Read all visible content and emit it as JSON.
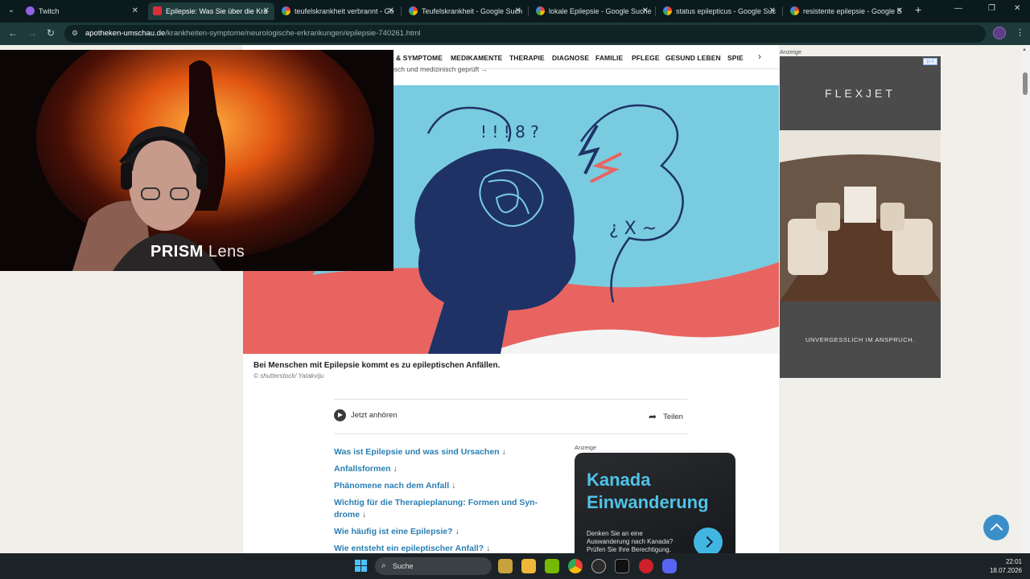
{
  "browser": {
    "tabs": [
      {
        "title": "Twitch",
        "favicon": "twitch-favicon",
        "active": false
      },
      {
        "title": "Epilepsie: Was Sie über die Kra",
        "favicon": "apotheken-umschau-favicon",
        "active": true
      },
      {
        "title": "teufelskrankheit verbrannt - Go",
        "favicon": "google-favicon",
        "active": false
      },
      {
        "title": "Teufelskrankheit - Google Such",
        "favicon": "google-favicon",
        "active": false
      },
      {
        "title": "lokale Epilepsie - Google Suche",
        "favicon": "google-favicon",
        "active": false
      },
      {
        "title": "status epilepticus - Google Suc",
        "favicon": "google-favicon",
        "active": false
      },
      {
        "title": "resistente epilepsie - Google S",
        "favicon": "google-favicon",
        "active": false
      }
    ],
    "url_host": "apotheken-umschau.de",
    "url_path": "/krankheiten-symptome/neurologische-erkrankungen/epilepsie-740261.html"
  },
  "site_nav": {
    "items": [
      "& SYMPTOME",
      "MEDIKAMENTE",
      "THERAPIE",
      "DIAGNOSE",
      "FAMILIE",
      "PFLEGE",
      "GESUND LEBEN",
      "SPIE"
    ],
    "subline": "isch und medizinisch geprüft"
  },
  "article": {
    "image_caption": "Bei Menschen mit Epilepsie kommt es zu epileptischen Anfällen.",
    "image_credit": "© shutterstock/ Yatakviju",
    "listen_label": "Jetzt anhören",
    "share_label": "Teilen",
    "toc": [
      {
        "label": "Was ist Epilepsie und was sind Ursachen"
      },
      {
        "label": "Anfallsformen"
      },
      {
        "label": "Phänomene nach dem Anfall"
      },
      {
        "label": "Wichtig für die Therapieplanung: Formen und Syn-drome"
      },
      {
        "label": "Wie häufig ist eine Epilepsie?"
      },
      {
        "label": "Wie entsteht ein epileptischer Anfall?"
      }
    ],
    "toc_arrow": "↓"
  },
  "ads": {
    "label": "Anzeige",
    "flexjet": {
      "logo": "FLEXJET",
      "slogan": "UNVERGESSLICH IM ANSPRUCH."
    },
    "kanada": {
      "title_line1": "Kanada",
      "title_line2": "Einwanderung",
      "text": "Denken Sie an eine Auswanderung nach Kanada? Prüfen Sie Ihre Berechtigung."
    }
  },
  "webcam": {
    "brand_bold": "PRISM",
    "brand_light": "Lens"
  },
  "taskbar": {
    "search_label": "Suche",
    "time": "22:01",
    "date": "18.07.2026"
  },
  "colors": {
    "link": "#2a7fb3",
    "accent_blue": "#3b8fc9",
    "hero_bg": "#79cce0",
    "hero_navy": "#1f3266",
    "hero_coral": "#e86461"
  }
}
